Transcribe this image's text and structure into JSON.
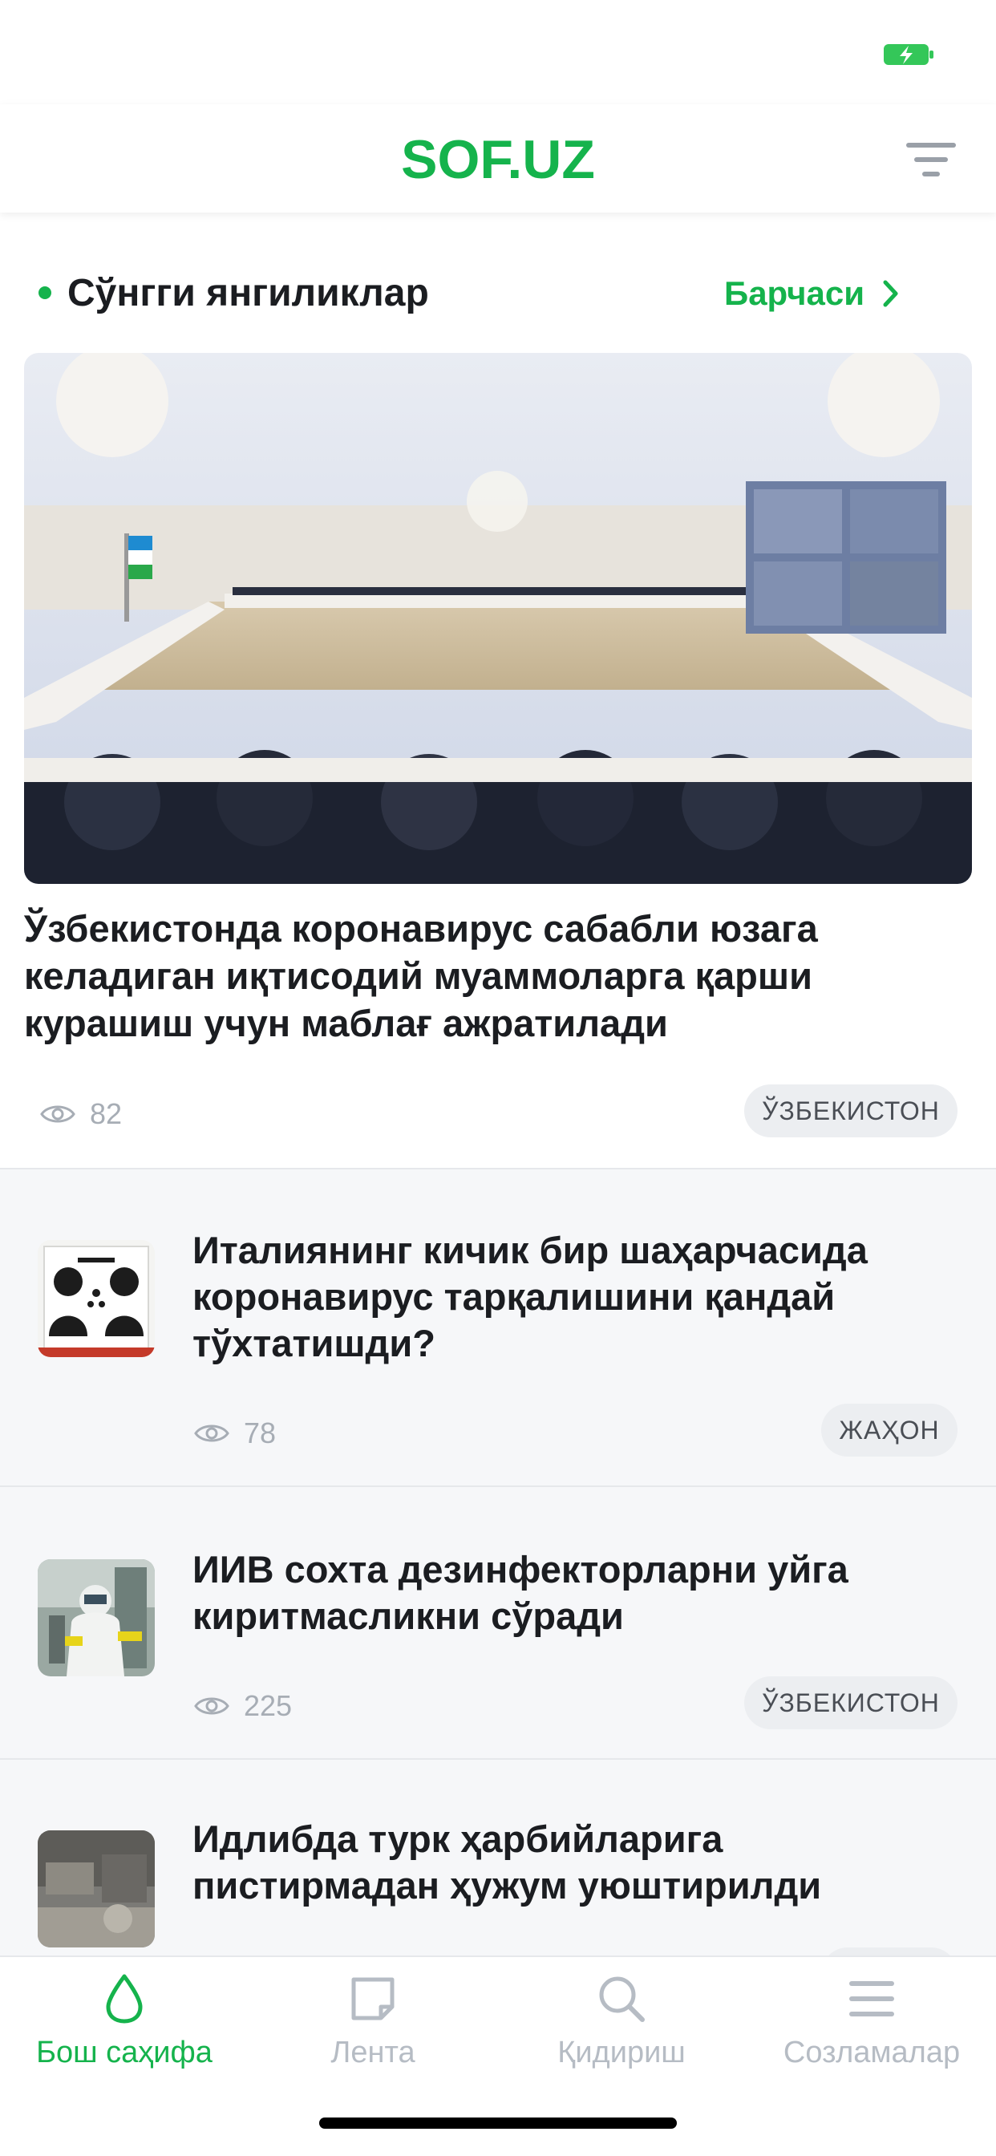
{
  "header": {
    "logo": "SOF.UZ"
  },
  "section": {
    "title": "Сўнгги янгиликлар",
    "see_all": "Барчаси"
  },
  "featured": {
    "title": "Ўзбекистонда коронавирус сабабли юзага келадиган иқтисодий муаммоларга қарши курашиш учун маблағ ажратилади",
    "views": "82",
    "tag": "ЎЗБЕКИСТОН"
  },
  "articles": [
    {
      "title": "Италиянинг кичик бир шаҳарчасида коронавирус тарқалишини қандай тўхтатишди?",
      "views": "78",
      "tag": "ЖАҲОН"
    },
    {
      "title": "ИИВ сохта дезинфекторларни уйга киритмасликни сўради",
      "views": "225",
      "tag": "ЎЗБЕКИСТОН"
    },
    {
      "title": "Идлибда турк ҳарбийларига пистирмадан ҳужум уюштирилди",
      "views": "",
      "tag": ""
    }
  ],
  "tabs": [
    {
      "label": "Бош саҳифа",
      "icon": "drop-icon",
      "active": true
    },
    {
      "label": "Лента",
      "icon": "note-icon",
      "active": false
    },
    {
      "label": "Қидириш",
      "icon": "search-icon",
      "active": false
    },
    {
      "label": "Созламалар",
      "icon": "menu-icon",
      "active": false
    }
  ],
  "colors": {
    "accent": "#15b34c",
    "text": "#1b1d21",
    "muted": "#a7adb5",
    "tag_bg": "#eceef1",
    "list_bg": "#f6f7f9"
  }
}
